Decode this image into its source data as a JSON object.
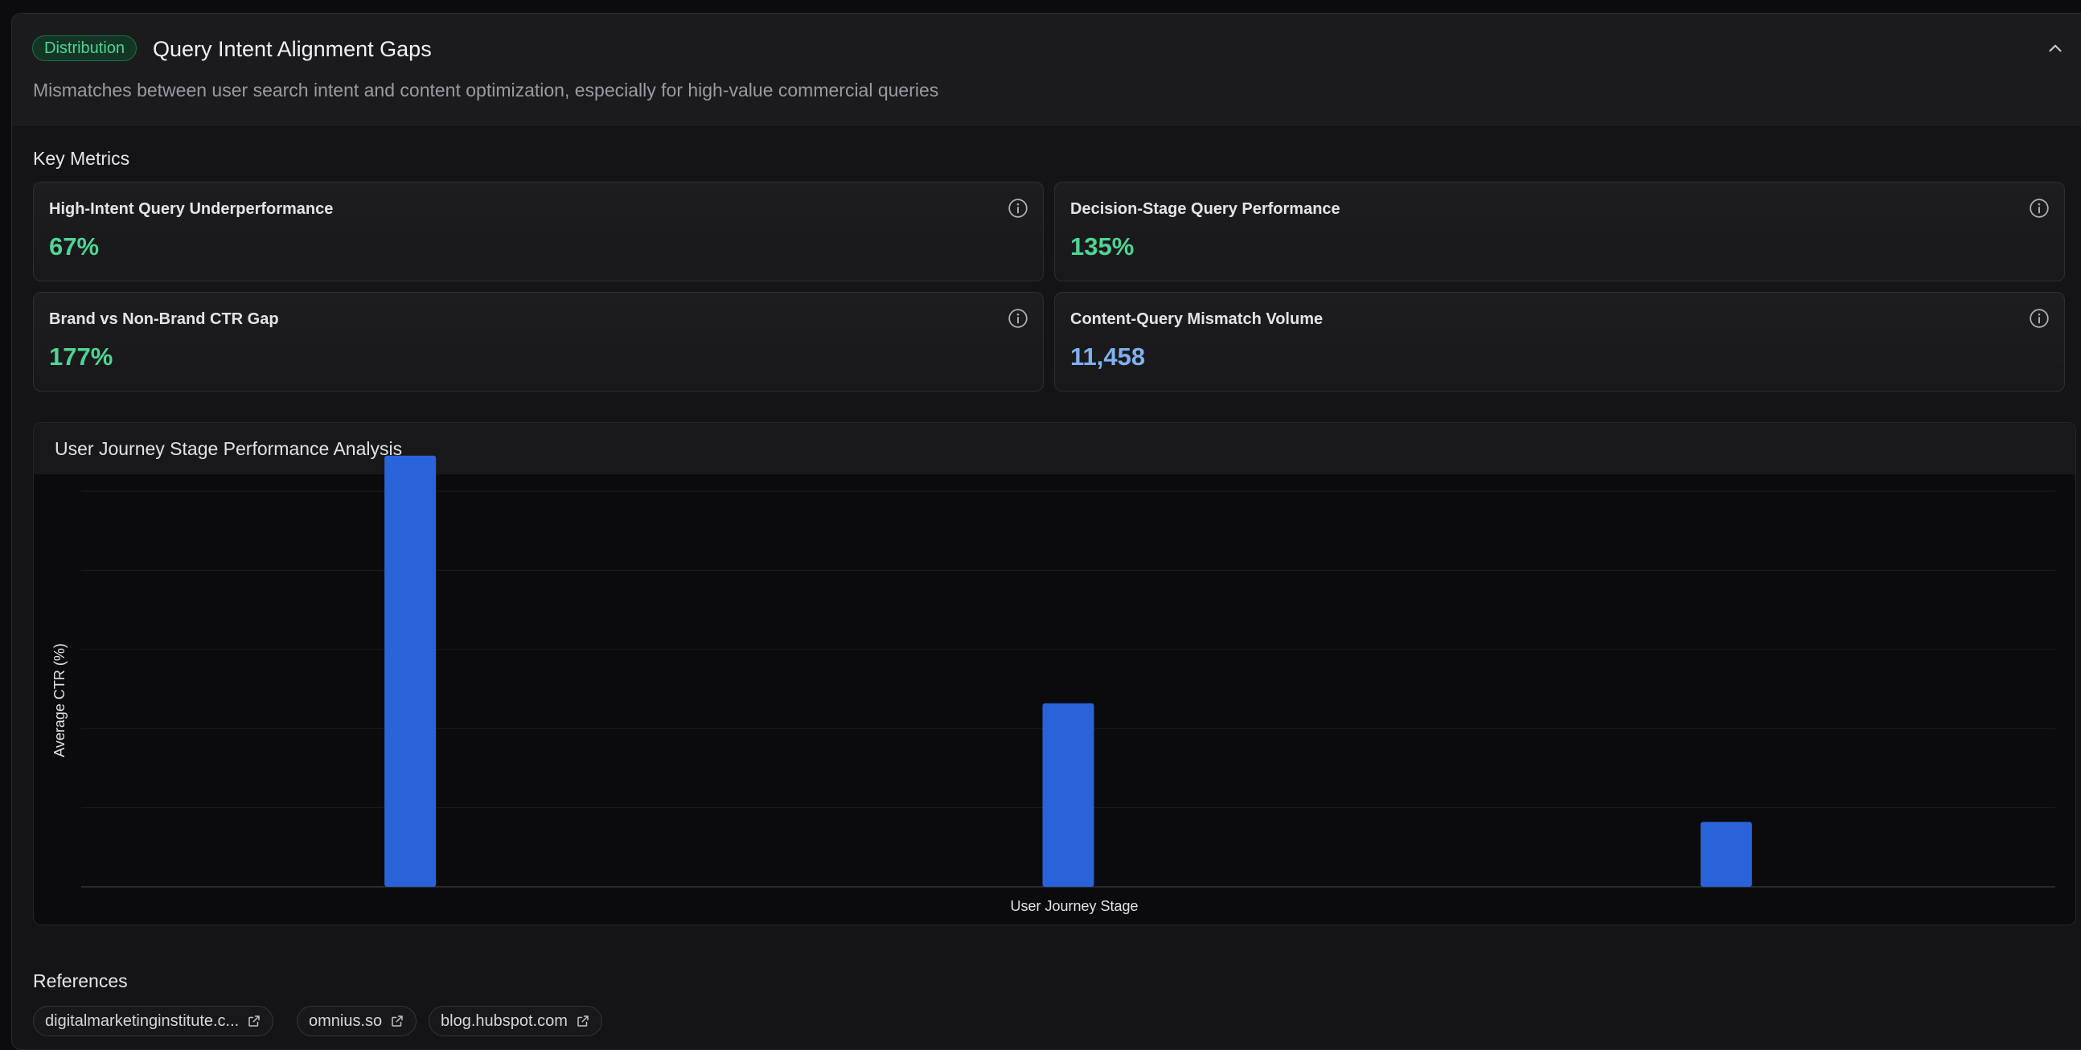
{
  "panel": {
    "badge": "Distribution",
    "title": "Query Intent Alignment Gaps",
    "description": "Mismatches between user search intent and content optimization, especially for high-value commercial queries",
    "collapse_icon": "chevron-up-icon"
  },
  "key_metrics": {
    "label": "Key Metrics",
    "cards": [
      {
        "label": "High-Intent Query Underperformance",
        "value": "67%",
        "color": "#4fd594"
      },
      {
        "label": "Decision-Stage Query Performance",
        "value": "135%",
        "color": "#4fd594"
      },
      {
        "label": "Brand vs Non-Brand CTR Gap",
        "value": "177%",
        "color": "#4fd594"
      },
      {
        "label": "Content-Query Mismatch Volume",
        "value": "11,458",
        "color": "#7fb0f0"
      }
    ]
  },
  "chart_data": {
    "type": "bar",
    "title": "User Journey Stage Performance Analysis",
    "xlabel": "User Journey Stage",
    "ylabel": "Average CTR (%)",
    "categories": [
      "",
      "",
      ""
    ],
    "values": [
      5.45,
      2.32,
      0.82
    ],
    "ylim": [
      0,
      5
    ],
    "grid": true,
    "bar_color": "#2a63d9"
  },
  "references": {
    "label": "References",
    "items": [
      {
        "label": "digitalmarketinginstitute.c..."
      },
      {
        "label": "omnius.so"
      },
      {
        "label": "blog.hubspot.com"
      }
    ]
  }
}
